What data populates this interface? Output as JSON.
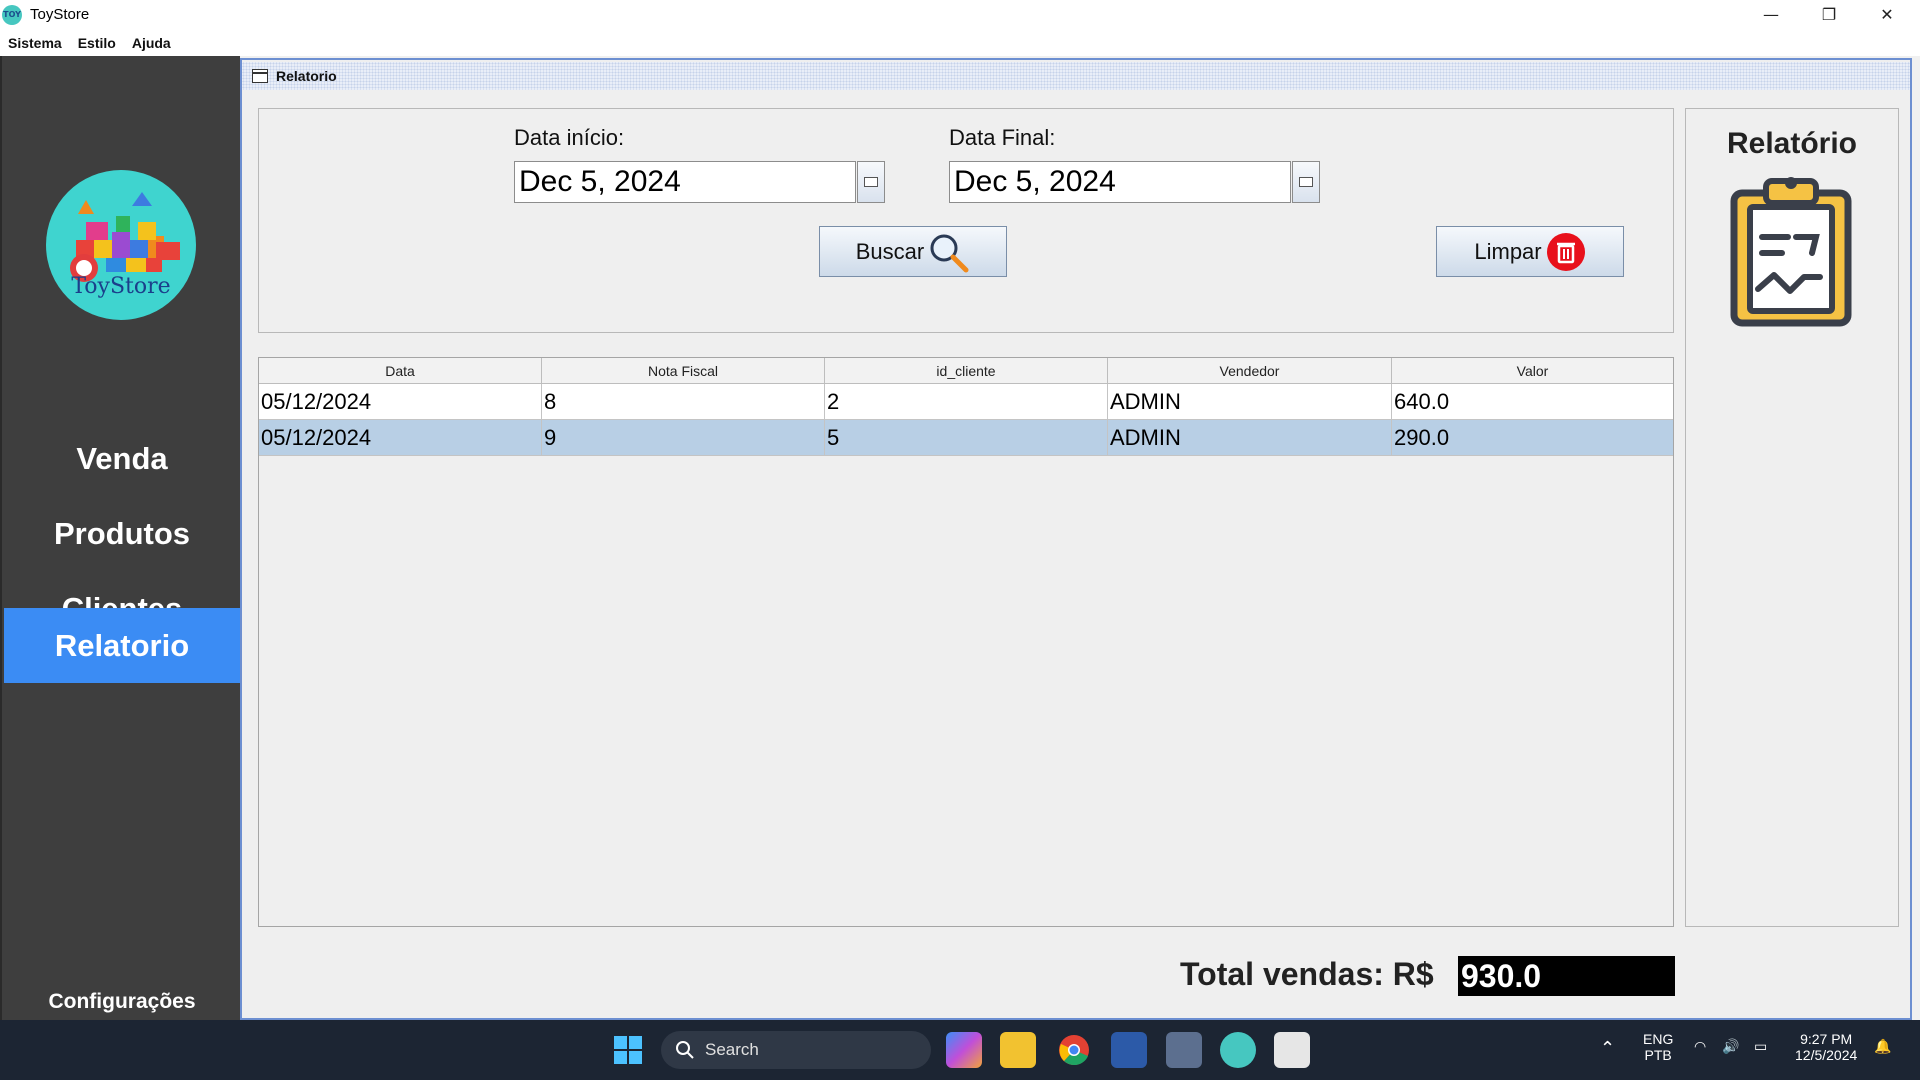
{
  "window": {
    "title": "ToyStore",
    "app_icon_text": "TOY",
    "minimize": "—",
    "maximize": "❐",
    "close": "✕"
  },
  "menu": [
    "Sistema",
    "Estilo",
    "Ajuda"
  ],
  "sidebar": {
    "logo_text": "ToyStore",
    "items": [
      {
        "label": "Venda",
        "active": false
      },
      {
        "label": "Produtos",
        "active": false
      },
      {
        "label": "Clientes",
        "active": false
      },
      {
        "label": "Relatorio",
        "active": true
      }
    ],
    "footer": "Configurações"
  },
  "frame": {
    "title": "Relatorio"
  },
  "filter": {
    "start_label": "Data início:",
    "start_value": "Dec 5, 2024",
    "end_label": "Data Final:",
    "end_value": "Dec 5, 2024",
    "search_button": "Buscar",
    "clear_button": "Limpar"
  },
  "table": {
    "columns": [
      "Data",
      "Nota Fiscal",
      "id_cliente",
      "Vendedor",
      "Valor"
    ],
    "rows": [
      [
        "05/12/2024",
        "8",
        "2",
        "ADMIN",
        "640.0"
      ],
      [
        "05/12/2024",
        "9",
        "5",
        "ADMIN",
        "290.0"
      ]
    ],
    "selected_row": 1
  },
  "right_panel": {
    "title": "Relatório",
    "icon": "clipboard-report-icon"
  },
  "total": {
    "label": "Total vendas: R$",
    "value": "930.0"
  },
  "taskbar": {
    "search_placeholder": "Search",
    "lang_top": "ENG",
    "lang_bottom": "PTB",
    "time": "9:27 PM",
    "date": "12/5/2024"
  },
  "colors": {
    "sidebar_bg": "#3e3e3e",
    "active_nav": "#3b8cf4",
    "selected_row": "#b8cfe5",
    "frame_border": "#6d8fd1"
  }
}
